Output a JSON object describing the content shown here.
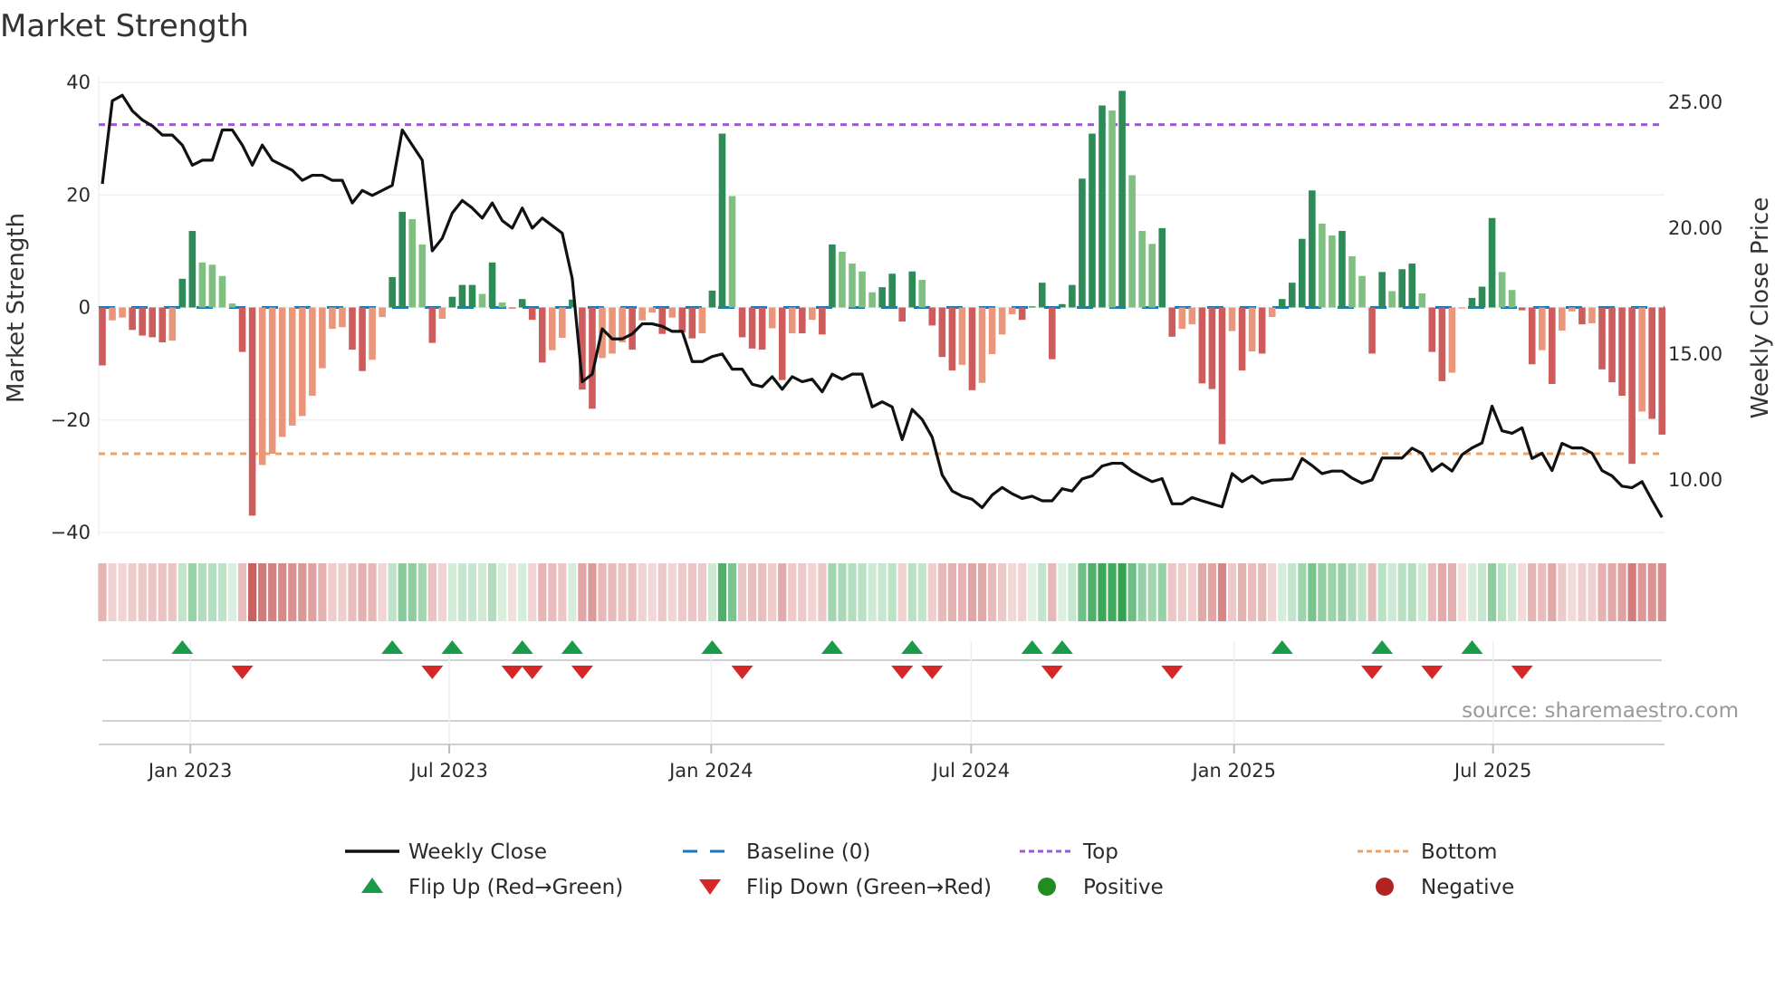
{
  "chart_data": {
    "type": "bar",
    "title": "Market Strength",
    "ylabel": "Market Strength",
    "y2label": "Weekly Close Price",
    "ylim": [
      -40,
      40
    ],
    "y2lim": [
      7.91,
      25.79
    ],
    "yticks": [
      40,
      20,
      0,
      -20,
      -40
    ],
    "ytick_labels": [
      "40",
      "20",
      "0",
      "−20",
      "−40"
    ],
    "y2ticks": [
      25,
      20,
      15,
      10
    ],
    "y2tick_labels": [
      "25.00",
      "20.00",
      "15.00",
      "10.00"
    ],
    "xticks": [
      {
        "week": 8.8,
        "label": "Jan 2023"
      },
      {
        "week": 34.7,
        "label": "Jul 2023"
      },
      {
        "week": 60.9,
        "label": "Jan 2024"
      },
      {
        "week": 86.9,
        "label": "Jul 2024"
      },
      {
        "week": 113.2,
        "label": "Jan 2025"
      },
      {
        "week": 139.1,
        "label": "Jul 2025"
      }
    ],
    "top_level": 32.5,
    "bottom_level": -26,
    "baseline": 0,
    "grid": true,
    "legend_position": "bottom",
    "series": [
      {
        "name": "Market Strength",
        "type": "bar",
        "values": [
          -10.3,
          -2.3,
          -1.8,
          -4,
          -5,
          -5.3,
          -6.2,
          -5.9,
          5.1,
          13.6,
          8,
          7.6,
          5.6,
          0.7,
          -7.9,
          -37,
          -28,
          -26,
          -23,
          -21,
          -19.3,
          -15.7,
          -10.8,
          -3.8,
          -3.5,
          -7.5,
          -11.3,
          -9.3,
          -1.7,
          5.4,
          17,
          15.7,
          11.2,
          -6.3,
          -2,
          1.9,
          4,
          4,
          2.4,
          8,
          0.9,
          -0.2,
          1.5,
          -2.2,
          -9.8,
          -7.6,
          -5.4,
          1.4,
          -14.6,
          -18,
          -9,
          -8.2,
          -6.2,
          -7.5,
          -2.3,
          -0.9,
          -4.7,
          -1.8,
          -4.4,
          -5.5,
          -4.6,
          3,
          30.9,
          19.8,
          -5.3,
          -7.3,
          -7.5,
          -3.7,
          -12.9,
          -4.6,
          -4.6,
          -2.2,
          -4.8,
          11.2,
          9.9,
          7.8,
          6.4,
          2.7,
          3.6,
          6,
          -2.5,
          6.4,
          4.9,
          -3.2,
          -8.8,
          -11.2,
          -10.2,
          -14.7,
          -13.4,
          -8.3,
          -4.8,
          -1.2,
          -2.2,
          0.2,
          4.4,
          -9.2,
          0.6,
          4,
          22.9,
          30.9,
          35.9,
          35,
          38.5,
          23.5,
          13.6,
          11.3,
          14.1,
          -5.2,
          -3.8,
          -3,
          -13.5,
          -14.5,
          -24.3,
          -4.2,
          -11.2,
          -7.8,
          -8.2,
          -1.7,
          1.5,
          4.4,
          12.2,
          20.8,
          14.9,
          12.8,
          13.6,
          9.1,
          5.6,
          -8.2,
          6.3,
          2.9,
          6.8,
          7.8,
          2.5,
          -7.9,
          -13.1,
          -11.6,
          -0.2,
          1.7,
          3.7,
          15.9,
          6.3,
          3.1,
          -0.5,
          -10.1,
          -7.6,
          -13.6,
          -4.1,
          -0.7,
          -3,
          -2.8,
          -11,
          -13.3,
          -15.7,
          -27.8,
          -18.5,
          -19.8,
          -22.6
        ]
      },
      {
        "name": "Weekly Close",
        "type": "line",
        "axis": "right",
        "values": [
          21.76,
          25.06,
          25.28,
          24.66,
          24.3,
          24.06,
          23.7,
          23.7,
          23.3,
          22.5,
          22.7,
          22.7,
          23.9,
          23.9,
          23.3,
          22.5,
          23.3,
          22.7,
          22.5,
          22.3,
          21.9,
          22.1,
          22.1,
          21.9,
          21.9,
          21.0,
          21.5,
          21.3,
          21.5,
          21.7,
          23.9,
          23.3,
          22.7,
          19.1,
          19.6,
          20.6,
          21.1,
          20.8,
          20.4,
          21.0,
          20.3,
          20.0,
          20.8,
          20.0,
          20.4,
          20.1,
          19.8,
          18.0,
          13.9,
          14.2,
          16.0,
          15.6,
          15.6,
          15.8,
          16.2,
          16.2,
          16.1,
          15.9,
          15.9,
          14.7,
          14.7,
          14.9,
          15.0,
          14.4,
          14.4,
          13.8,
          13.7,
          14.1,
          13.6,
          14.1,
          13.9,
          14.0,
          13.5,
          14.2,
          14.0,
          14.2,
          14.2,
          12.9,
          13.1,
          12.9,
          11.6,
          12.8,
          12.4,
          11.7,
          10.2,
          9.56,
          9.35,
          9.23,
          8.9,
          9.4,
          9.7,
          9.45,
          9.26,
          9.35,
          9.17,
          9.17,
          9.65,
          9.56,
          10.04,
          10.16,
          10.55,
          10.66,
          10.66,
          10.35,
          10.13,
          9.93,
          10.05,
          9.05,
          9.05,
          9.3,
          9.17,
          9.05,
          8.93,
          10.25,
          9.93,
          10.16,
          9.87,
          9.99,
          10.0,
          10.04,
          10.85,
          10.57,
          10.25,
          10.35,
          10.35,
          10.07,
          9.87,
          10.0,
          10.87,
          10.87,
          10.87,
          11.26,
          11.05,
          10.35,
          10.64,
          10.35,
          11.0,
          11.27,
          11.47,
          12.93,
          11.95,
          11.85,
          12.07,
          10.85,
          11.06,
          10.37,
          11.45,
          11.27,
          11.27,
          11.06,
          10.37,
          10.16,
          9.75,
          9.69,
          9.93,
          9.2,
          8.51
        ]
      }
    ],
    "colors": {
      "pos_strong": "#2e8b57",
      "pos_weak": "#7fbf7f",
      "neg_strong": "#cd5c5c",
      "neg_weak": "#e9967a",
      "close": "#111111",
      "baseline": "#1f77b4",
      "top": "#9b59d6",
      "bottom": "#f0a060",
      "flip_up": "#1a9b4a",
      "flip_down": "#d62728",
      "positive": "#228b22",
      "negative": "#b22222"
    },
    "source": "source: sharemaestro.com",
    "legend": [
      {
        "label": "Weekly Close",
        "symbol": "solid-line"
      },
      {
        "label": "Baseline (0)",
        "symbol": "dashed-line"
      },
      {
        "label": "Top",
        "symbol": "dotted-line-purple"
      },
      {
        "label": "Bottom",
        "symbol": "dotted-line-orange"
      },
      {
        "label": "Flip Up (Red→Green)",
        "symbol": "triangle-up"
      },
      {
        "label": "Flip Down (Green→Red)",
        "symbol": "triangle-down"
      },
      {
        "label": "Positive",
        "symbol": "circle-green"
      },
      {
        "label": "Negative",
        "symbol": "circle-red"
      }
    ]
  }
}
